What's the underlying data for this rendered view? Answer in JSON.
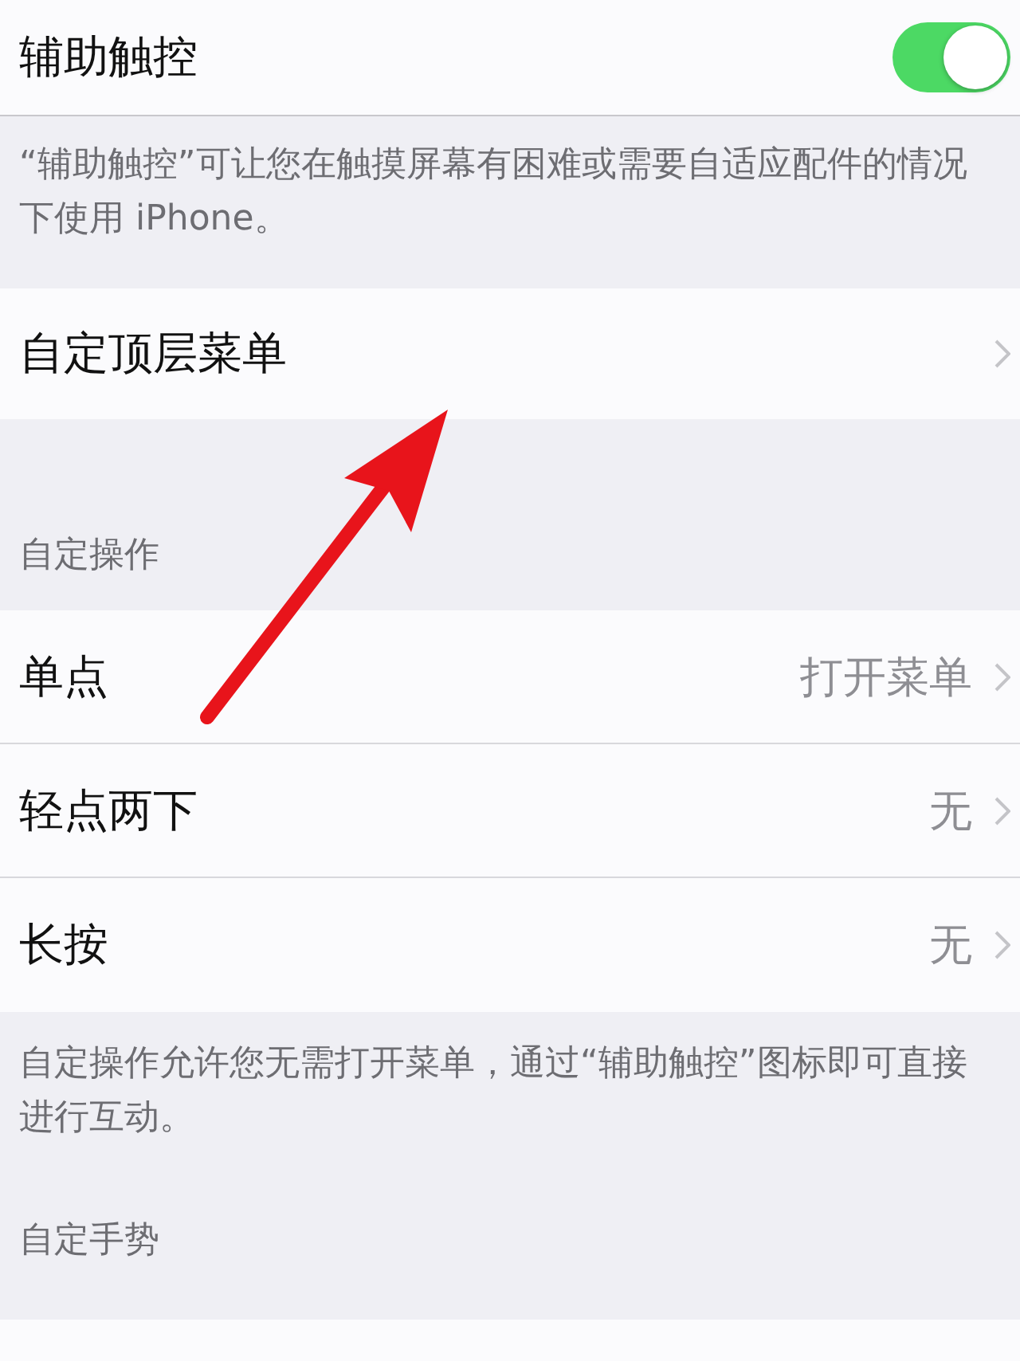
{
  "main_toggle": {
    "label": "辅助触控",
    "on": true
  },
  "main_footer": "“辅助触控”可让您在触摸屏幕有困难或需要自适应配件的情况下使用 iPhone。",
  "top_menu_row": {
    "label": "自定顶层菜单"
  },
  "custom_actions": {
    "header": "自定操作",
    "rows": [
      {
        "label": "单点",
        "value": "打开菜单"
      },
      {
        "label": "轻点两下",
        "value": "无"
      },
      {
        "label": "长按",
        "value": "无"
      }
    ],
    "footer": "自定操作允许您无需打开菜单，通过“辅助触控”图标即可直接进行互动。"
  },
  "custom_gestures": {
    "header": "自定手势"
  }
}
